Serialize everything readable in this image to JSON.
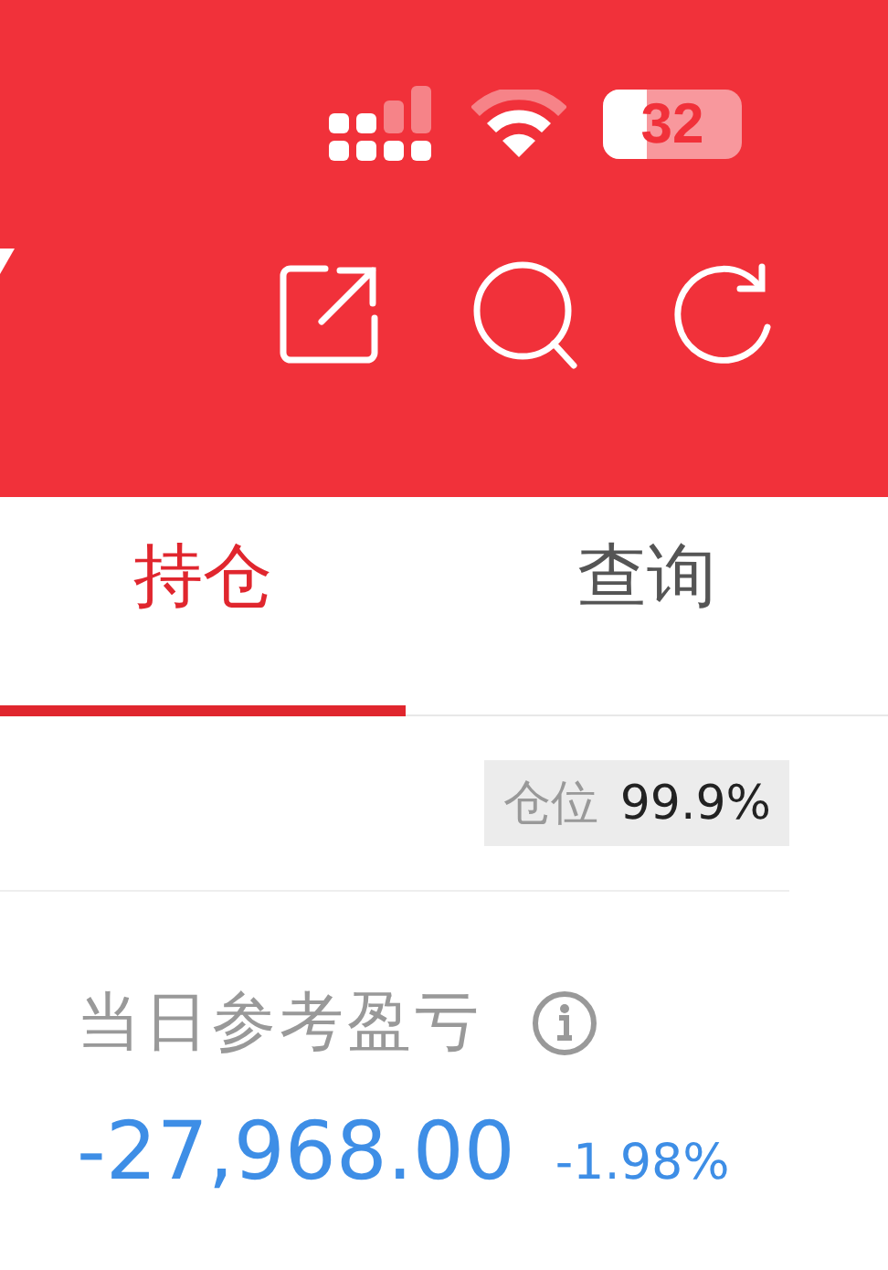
{
  "status_bar": {
    "battery": "32"
  },
  "tabs": [
    {
      "label": "持仓",
      "selected": true
    },
    {
      "label": "查询",
      "selected": false
    }
  ],
  "position": {
    "label": "仓位",
    "value": "99.9%"
  },
  "profit": {
    "label": "当日参考盈亏",
    "value": "-27,968.00",
    "change": "-1.98%"
  }
}
